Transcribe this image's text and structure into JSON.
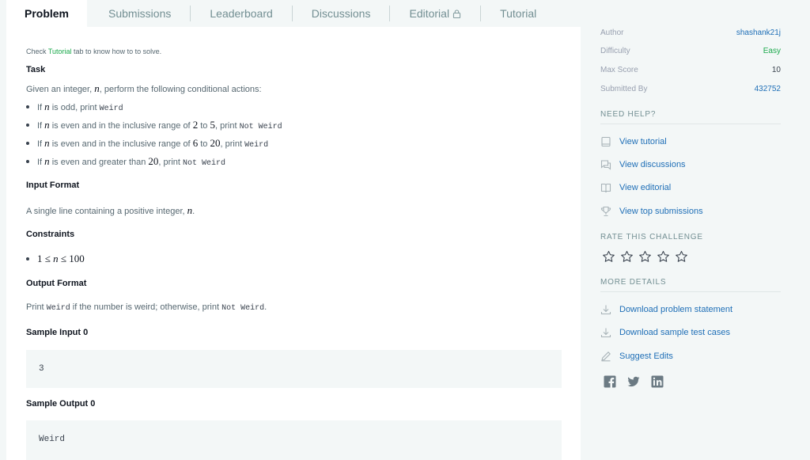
{
  "tabs": {
    "problem": "Problem",
    "submissions": "Submissions",
    "leaderboard": "Leaderboard",
    "discussions": "Discussions",
    "editorial": "Editorial",
    "tutorial": "Tutorial"
  },
  "hint": {
    "pre": "Check ",
    "link": "Tutorial",
    "post": " tab to know how to to solve."
  },
  "task": {
    "heading": "Task",
    "intro_pre": "Given an integer, ",
    "intro_var": "n",
    "intro_post": ", perform the following conditional actions:",
    "b1_pre": "If ",
    "b1_var": "n",
    "b1_mid": " is odd, print ",
    "b1_code": "Weird",
    "b2_pre": "If ",
    "b2_var": "n",
    "b2_mid": " is even and in the inclusive range of ",
    "b2_a": "2",
    "b2_to": " to ",
    "b2_b": "5",
    "b2_post": ", print ",
    "b2_code": "Not Weird",
    "b3_pre": "If ",
    "b3_var": "n",
    "b3_mid": " is even and in the inclusive range of ",
    "b3_a": "6",
    "b3_to": " to ",
    "b3_b": "20",
    "b3_post": ", print ",
    "b3_code": "Weird",
    "b4_pre": "If ",
    "b4_var": "n",
    "b4_mid": " is even and greater than ",
    "b4_a": "20",
    "b4_post": ", print ",
    "b4_code": "Not Weird"
  },
  "input_format": {
    "heading": "Input Format",
    "text_pre": "A single line containing a positive integer, ",
    "text_var": "n",
    "text_post": "."
  },
  "constraints": {
    "heading": "Constraints",
    "lo": "1",
    "le1": " ≤ ",
    "var": "n",
    "le2": " ≤ ",
    "hi": "100"
  },
  "output_format": {
    "heading": "Output Format",
    "pre": "Print ",
    "code1": "Weird",
    "mid": " if the number is weird; otherwise, print ",
    "code2": "Not Weird",
    "post": "."
  },
  "sample_input": {
    "heading": "Sample Input 0",
    "value": "3"
  },
  "sample_output": {
    "heading": "Sample Output 0",
    "value": "Weird"
  },
  "sidebar": {
    "author_label": "Author",
    "author": "shashank21j",
    "difficulty_label": "Difficulty",
    "difficulty": "Easy",
    "max_score_label": "Max Score",
    "max_score": "10",
    "submitted_label": "Submitted By",
    "submitted": "432752",
    "need_help": "NEED HELP?",
    "view_tutorial": "View tutorial",
    "view_discussions": "View discussions",
    "view_editorial": "View editorial",
    "view_top": "View top submissions",
    "rate": "RATE THIS CHALLENGE",
    "rating": 0,
    "more": "MORE DETAILS",
    "download_statement": "Download problem statement",
    "download_tests": "Download sample test cases",
    "suggest": "Suggest Edits"
  },
  "colors": {
    "accent_green": "#1ba94c",
    "link_blue": "#1f6fb7",
    "icon_grey": "#a8b3b8"
  },
  "icons": [
    "lock-icon",
    "tutorial-icon",
    "discussions-icon",
    "editorial-icon",
    "trophy-icon",
    "star-icon",
    "download-icon",
    "pencil-icon",
    "facebook-icon",
    "twitter-icon",
    "linkedin-icon"
  ]
}
